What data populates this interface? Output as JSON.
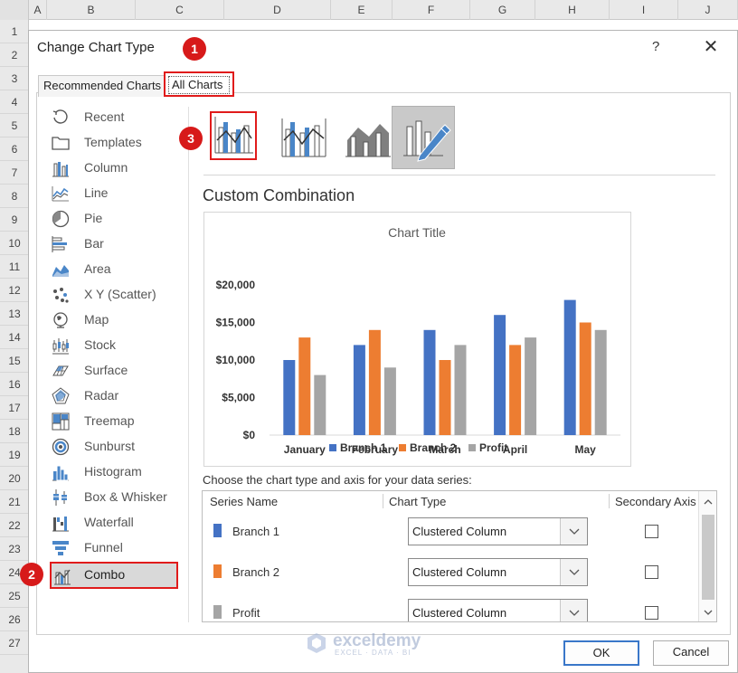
{
  "sheet": {
    "columns": [
      "A",
      "B",
      "C",
      "D",
      "E",
      "F",
      "G",
      "H",
      "I",
      "J"
    ],
    "rows": [
      "1",
      "2",
      "3",
      "4",
      "5",
      "6",
      "7",
      "8",
      "9",
      "10",
      "11",
      "12",
      "13",
      "14",
      "15",
      "16",
      "17",
      "18",
      "19",
      "20",
      "21",
      "22",
      "23",
      "24",
      "25",
      "26",
      "27"
    ]
  },
  "dialog": {
    "title": "Change Chart Type",
    "help": "?",
    "close": "✕",
    "tabs": [
      {
        "label": "Recommended Charts"
      },
      {
        "label": "All Charts"
      }
    ]
  },
  "chart_types": [
    {
      "label": "Recent",
      "icon": "recent-icon"
    },
    {
      "label": "Templates",
      "icon": "templates-icon"
    },
    {
      "label": "Column",
      "icon": "column-chart-icon"
    },
    {
      "label": "Line",
      "icon": "line-chart-icon"
    },
    {
      "label": "Pie",
      "icon": "pie-chart-icon"
    },
    {
      "label": "Bar",
      "icon": "bar-chart-icon"
    },
    {
      "label": "Area",
      "icon": "area-chart-icon"
    },
    {
      "label": "X Y (Scatter)",
      "icon": "scatter-chart-icon"
    },
    {
      "label": "Map",
      "icon": "map-chart-icon"
    },
    {
      "label": "Stock",
      "icon": "stock-chart-icon"
    },
    {
      "label": "Surface",
      "icon": "surface-chart-icon"
    },
    {
      "label": "Radar",
      "icon": "radar-chart-icon"
    },
    {
      "label": "Treemap",
      "icon": "treemap-chart-icon"
    },
    {
      "label": "Sunburst",
      "icon": "sunburst-chart-icon"
    },
    {
      "label": "Histogram",
      "icon": "histogram-chart-icon"
    },
    {
      "label": "Box & Whisker",
      "icon": "box-whisker-chart-icon"
    },
    {
      "label": "Waterfall",
      "icon": "waterfall-chart-icon"
    },
    {
      "label": "Funnel",
      "icon": "funnel-chart-icon"
    },
    {
      "label": "Combo",
      "icon": "combo-chart-icon",
      "selected": true
    }
  ],
  "subtypes": {
    "heading": "Custom Combination",
    "selected_index": 3,
    "icons": [
      "clustered-column-line-icon",
      "clustered-column-line-secondary-axis-icon",
      "stacked-area-clustered-column-icon",
      "custom-combination-icon"
    ]
  },
  "chart_data": {
    "type": "bar",
    "title": "Chart Title",
    "categories": [
      "January",
      "February",
      "March",
      "April",
      "May"
    ],
    "series": [
      {
        "name": "Branch 1",
        "values": [
          10000,
          12000,
          14000,
          16000,
          18000
        ]
      },
      {
        "name": "Branch 2",
        "values": [
          13000,
          14000,
          10000,
          12000,
          15000
        ]
      },
      {
        "name": "Profit",
        "values": [
          8000,
          9000,
          12000,
          13000,
          14000
        ]
      }
    ],
    "colors": [
      "#4472c4",
      "#ed7d31",
      "#a5a5a5"
    ],
    "ylim": [
      0,
      20000
    ],
    "yticks": [
      0,
      5000,
      10000,
      15000,
      20000
    ],
    "ytick_labels": [
      "$0",
      "$5,000",
      "$10,000",
      "$15,000",
      "$20,000"
    ],
    "legend": "bottom",
    "grid": false
  },
  "series_table": {
    "caption": "Choose the chart type and axis for your data series:",
    "headers": {
      "name": "Series Name",
      "type": "Chart Type",
      "axis": "Secondary Axis"
    },
    "rows": [
      {
        "name": "Branch 1",
        "type": "Clustered Column",
        "color": "#4472c4",
        "secondary": false
      },
      {
        "name": "Branch 2",
        "type": "Clustered Column",
        "color": "#ed7d31",
        "secondary": false
      },
      {
        "name": "Profit",
        "type": "Clustered Column",
        "color": "#a5a5a5",
        "secondary": false
      }
    ]
  },
  "buttons": {
    "ok": "OK",
    "cancel": "Cancel"
  },
  "badges": [
    "1",
    "2",
    "3"
  ],
  "watermark": {
    "name": "exceldemy",
    "tagline": "EXCEL · DATA · BI"
  }
}
